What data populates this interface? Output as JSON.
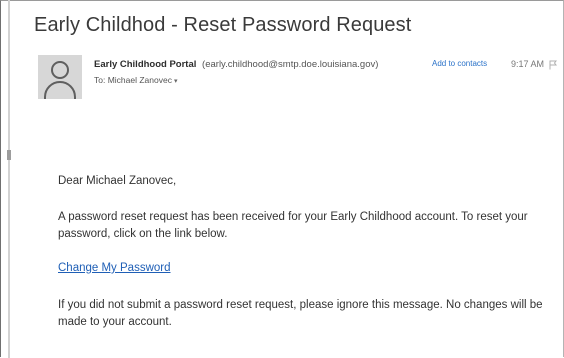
{
  "email": {
    "subject": "Early Childhod - Reset Password Request",
    "sender_name": "Early Childhood Portal",
    "sender_email": "(early.childhood@smtp.doe.louisiana.gov)",
    "add_to_contacts": "Add to contacts",
    "time": "9:17 AM",
    "to": "To: Michael Zanovec",
    "to_chevron": "▾",
    "greeting": "Dear Michael Zanovec,",
    "paragraph1": "A password reset request has been received for your Early Childhood account. To reset your password, click on the link below.",
    "link_text": "Change My Password",
    "paragraph2": "If you did not submit a password reset request, please ignore this message. No changes will be made to your account."
  },
  "icons": {
    "avatar": "person-silhouette-icon",
    "flag": "flag-icon"
  },
  "colors": {
    "link": "#1f5fb6",
    "add_contacts": "#2a72c9",
    "avatar_bg": "#d7d7d7"
  }
}
